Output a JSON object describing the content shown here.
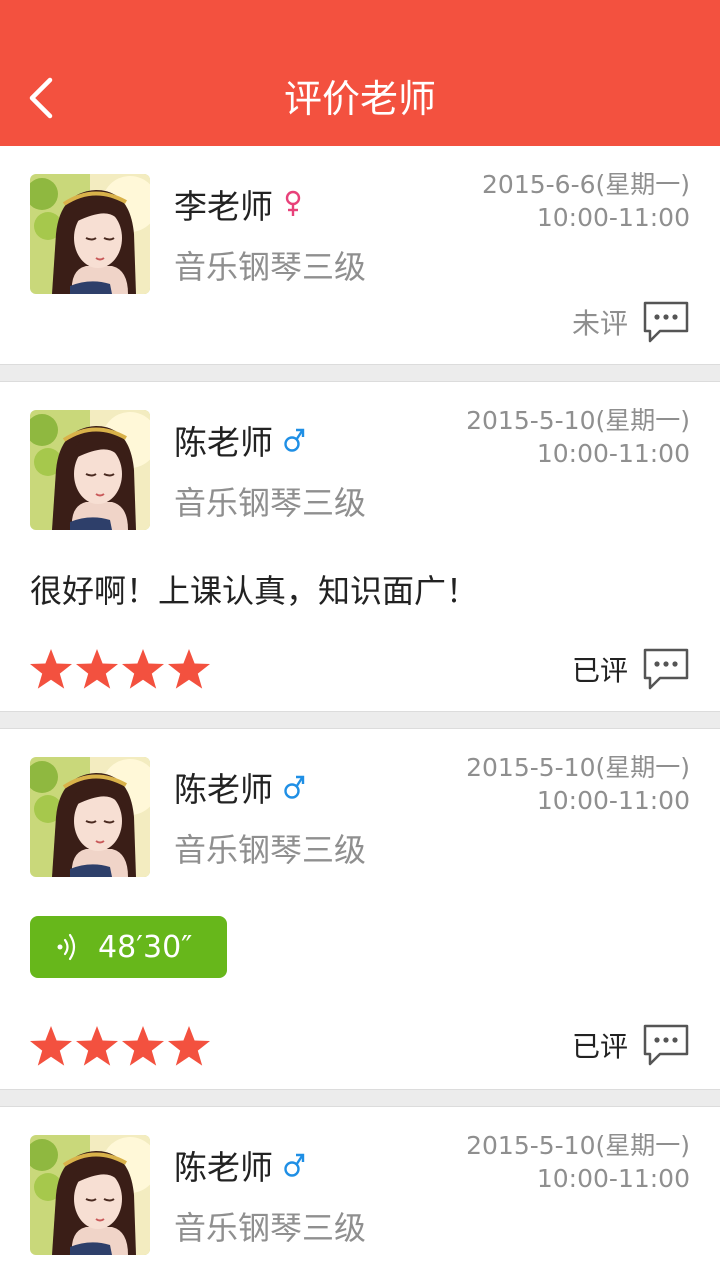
{
  "header": {
    "title": "评价老师",
    "back_icon": "chevron-left-icon"
  },
  "colors": {
    "accent": "#f3513f",
    "star": "#f3513f",
    "female": "#e8417a",
    "male": "#1f8fe5",
    "audio": "#67b71b"
  },
  "records": [
    {
      "teacher": "李老师",
      "gender": "female",
      "course": "音乐钢琴三级",
      "date": "2015-6-6(星期一)",
      "time": "10:00-11:00",
      "status": "未评",
      "rated": false
    },
    {
      "teacher": "陈老师",
      "gender": "male",
      "course": "音乐钢琴三级",
      "date": "2015-5-10(星期一)",
      "time": "10:00-11:00",
      "comment": "很好啊！上课认真，知识面广！",
      "stars": 4,
      "status": "已评",
      "rated": true
    },
    {
      "teacher": "陈老师",
      "gender": "male",
      "course": "音乐钢琴三级",
      "date": "2015-5-10(星期一)",
      "time": "10:00-11:00",
      "audio_duration": "48′30″",
      "stars": 4,
      "status": "已评",
      "rated": true
    },
    {
      "teacher": "陈老师",
      "gender": "male",
      "course": "音乐钢琴三级",
      "date": "2015-5-10(星期一)",
      "time": "10:00-11:00"
    }
  ]
}
